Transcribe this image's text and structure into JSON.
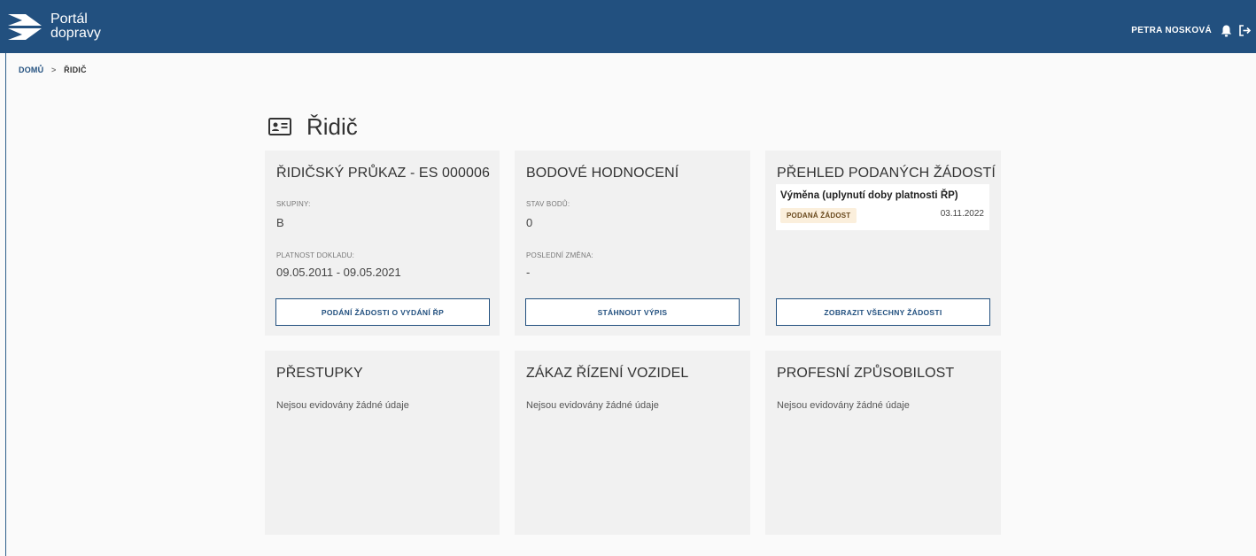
{
  "header": {
    "brand_line1": "Portál",
    "brand_line2": "dopravy",
    "user_name": "PETRA NOSKOVÁ",
    "accent": "#22507f"
  },
  "breadcrumb": {
    "home": "DOMŮ",
    "separator": ">",
    "current": "ŘIDIČ"
  },
  "page": {
    "title": "Řidič",
    "title_icon": "id-card-icon"
  },
  "license_card": {
    "title": "ŘIDIČSKÝ PRŮKAZ - ES 000006",
    "groups_label": "SKUPINY:",
    "groups_value": "B",
    "validity_label": "PLATNOST DOKLADU:",
    "validity_value": "09.05.2011 - 09.05.2021",
    "button": "PODÁNÍ ŽÁDOSTI O VYDÁNÍ ŘP"
  },
  "points_card": {
    "title": "BODOVÉ HODNOCENÍ",
    "points_label": "STAV BODŮ:",
    "points_value": "0",
    "last_change_label": "POSLEDNÍ ZMĚNA:",
    "last_change_value": "-",
    "button": "STÁHNOUT VÝPIS"
  },
  "requests_card": {
    "title": "PŘEHLED PODANÝCH ŽÁDOSTÍ",
    "items": [
      {
        "title": "Výměna (uplynutí doby platnosti ŘP)",
        "status": "PODANÁ ŽÁDOST",
        "date": "03.11.2022"
      }
    ],
    "button": "ZOBRAZIT VŠECHNY ŽÁDOSTI"
  },
  "offenses_card": {
    "title": "PŘESTUPKY",
    "empty": "Nejsou evidovány žádné údaje"
  },
  "ban_card": {
    "title": "ZÁKAZ ŘÍZENÍ VOZIDEL",
    "empty": "Nejsou evidovány žádné údaje"
  },
  "competence_card": {
    "title": "PROFESNÍ ZPŮSOBILOST",
    "empty": "Nejsou evidovány žádné údaje"
  }
}
